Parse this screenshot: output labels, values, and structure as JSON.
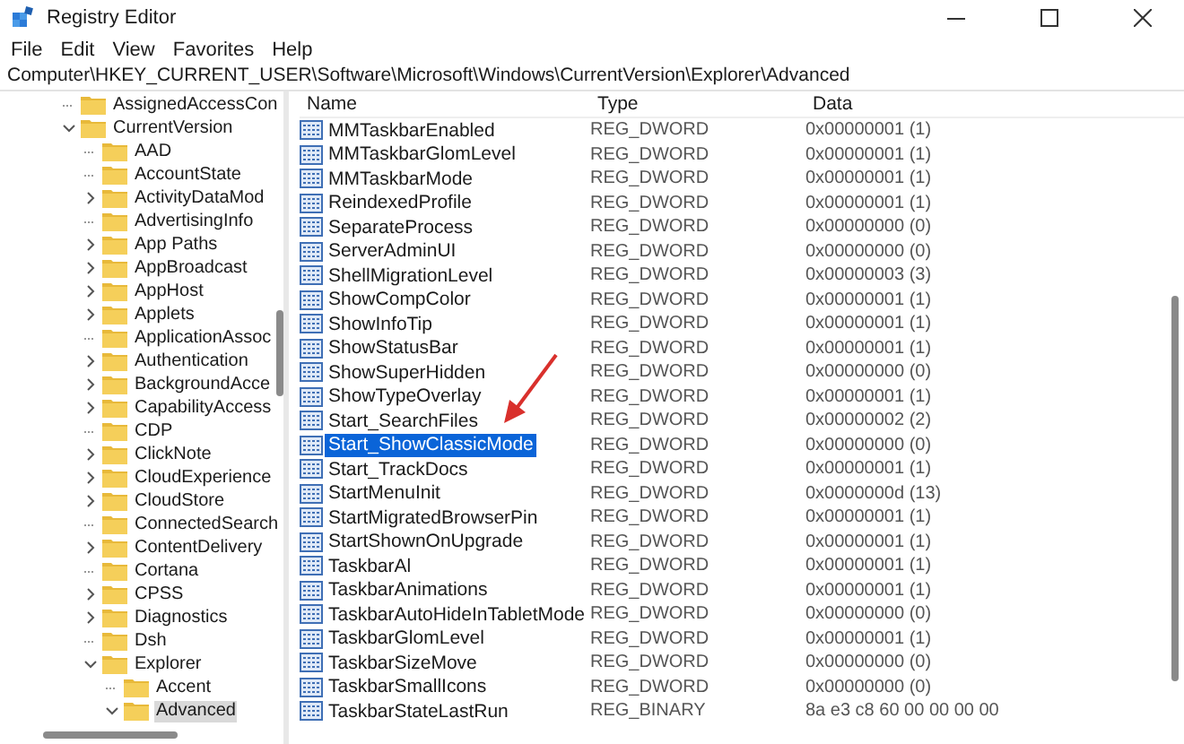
{
  "window": {
    "title": "Registry Editor"
  },
  "menu": [
    {
      "label": "File"
    },
    {
      "label": "Edit"
    },
    {
      "label": "View"
    },
    {
      "label": "Favorites"
    },
    {
      "label": "Help"
    }
  ],
  "address": "Computer\\HKEY_CURRENT_USER\\Software\\Microsoft\\Windows\\CurrentVersion\\Explorer\\Advanced",
  "tree": [
    {
      "label": "AssignedAccessCon",
      "kind": "leaf",
      "selected": false
    },
    {
      "label": "CurrentVersion",
      "kind": "branch",
      "expanded": true,
      "selected": false,
      "children": [
        {
          "label": "AAD",
          "kind": "leaf",
          "selected": false
        },
        {
          "label": "AccountState",
          "kind": "leaf",
          "selected": false
        },
        {
          "label": "ActivityDataMod",
          "kind": "branch",
          "expanded": false,
          "selected": false
        },
        {
          "label": "AdvertisingInfo",
          "kind": "leaf",
          "selected": false
        },
        {
          "label": "App Paths",
          "kind": "branch",
          "expanded": false,
          "selected": false
        },
        {
          "label": "AppBroadcast",
          "kind": "branch",
          "expanded": false,
          "selected": false
        },
        {
          "label": "AppHost",
          "kind": "branch",
          "expanded": false,
          "selected": false
        },
        {
          "label": "Applets",
          "kind": "branch",
          "expanded": false,
          "selected": false
        },
        {
          "label": "ApplicationAssoc",
          "kind": "leaf",
          "selected": false
        },
        {
          "label": "Authentication",
          "kind": "branch",
          "expanded": false,
          "selected": false
        },
        {
          "label": "BackgroundAcce",
          "kind": "branch",
          "expanded": false,
          "selected": false
        },
        {
          "label": "CapabilityAccess",
          "kind": "branch",
          "expanded": false,
          "selected": false
        },
        {
          "label": "CDP",
          "kind": "leaf",
          "selected": false
        },
        {
          "label": "ClickNote",
          "kind": "branch",
          "expanded": false,
          "selected": false
        },
        {
          "label": "CloudExperience",
          "kind": "branch",
          "expanded": false,
          "selected": false
        },
        {
          "label": "CloudStore",
          "kind": "branch",
          "expanded": false,
          "selected": false
        },
        {
          "label": "ConnectedSearch",
          "kind": "leaf",
          "selected": false
        },
        {
          "label": "ContentDelivery",
          "kind": "branch",
          "expanded": false,
          "selected": false
        },
        {
          "label": "Cortana",
          "kind": "leaf",
          "selected": false
        },
        {
          "label": "CPSS",
          "kind": "branch",
          "expanded": false,
          "selected": false
        },
        {
          "label": "Diagnostics",
          "kind": "branch",
          "expanded": false,
          "selected": false
        },
        {
          "label": "Dsh",
          "kind": "leaf",
          "selected": false
        },
        {
          "label": "Explorer",
          "kind": "branch",
          "expanded": true,
          "selected": false,
          "children": [
            {
              "label": "Accent",
              "kind": "leaf",
              "selected": false
            },
            {
              "label": "Advanced",
              "kind": "branch",
              "expanded": true,
              "selected": true
            }
          ]
        }
      ]
    }
  ],
  "table": {
    "columns": [
      "Name",
      "Type",
      "Data"
    ],
    "rows": [
      {
        "name": "MMTaskbarEnabled",
        "type": "REG_DWORD",
        "data": "0x00000001 (1)",
        "selected": false
      },
      {
        "name": "MMTaskbarGlomLevel",
        "type": "REG_DWORD",
        "data": "0x00000001 (1)",
        "selected": false
      },
      {
        "name": "MMTaskbarMode",
        "type": "REG_DWORD",
        "data": "0x00000001 (1)",
        "selected": false
      },
      {
        "name": "ReindexedProfile",
        "type": "REG_DWORD",
        "data": "0x00000001 (1)",
        "selected": false
      },
      {
        "name": "SeparateProcess",
        "type": "REG_DWORD",
        "data": "0x00000000 (0)",
        "selected": false
      },
      {
        "name": "ServerAdminUI",
        "type": "REG_DWORD",
        "data": "0x00000000 (0)",
        "selected": false
      },
      {
        "name": "ShellMigrationLevel",
        "type": "REG_DWORD",
        "data": "0x00000003 (3)",
        "selected": false
      },
      {
        "name": "ShowCompColor",
        "type": "REG_DWORD",
        "data": "0x00000001 (1)",
        "selected": false
      },
      {
        "name": "ShowInfoTip",
        "type": "REG_DWORD",
        "data": "0x00000001 (1)",
        "selected": false
      },
      {
        "name": "ShowStatusBar",
        "type": "REG_DWORD",
        "data": "0x00000001 (1)",
        "selected": false
      },
      {
        "name": "ShowSuperHidden",
        "type": "REG_DWORD",
        "data": "0x00000000 (0)",
        "selected": false
      },
      {
        "name": "ShowTypeOverlay",
        "type": "REG_DWORD",
        "data": "0x00000001 (1)",
        "selected": false
      },
      {
        "name": "Start_SearchFiles",
        "type": "REG_DWORD",
        "data": "0x00000002 (2)",
        "selected": false
      },
      {
        "name": "Start_ShowClassicMode",
        "type": "REG_DWORD",
        "data": "0x00000000 (0)",
        "selected": true
      },
      {
        "name": "Start_TrackDocs",
        "type": "REG_DWORD",
        "data": "0x00000001 (1)",
        "selected": false
      },
      {
        "name": "StartMenuInit",
        "type": "REG_DWORD",
        "data": "0x0000000d (13)",
        "selected": false
      },
      {
        "name": "StartMigratedBrowserPin",
        "type": "REG_DWORD",
        "data": "0x00000001 (1)",
        "selected": false
      },
      {
        "name": "StartShownOnUpgrade",
        "type": "REG_DWORD",
        "data": "0x00000001 (1)",
        "selected": false
      },
      {
        "name": "TaskbarAl",
        "type": "REG_DWORD",
        "data": "0x00000001 (1)",
        "selected": false
      },
      {
        "name": "TaskbarAnimations",
        "type": "REG_DWORD",
        "data": "0x00000001 (1)",
        "selected": false
      },
      {
        "name": "TaskbarAutoHideInTabletMode",
        "type": "REG_DWORD",
        "data": "0x00000000 (0)",
        "selected": false
      },
      {
        "name": "TaskbarGlomLevel",
        "type": "REG_DWORD",
        "data": "0x00000001 (1)",
        "selected": false
      },
      {
        "name": "TaskbarSizeMove",
        "type": "REG_DWORD",
        "data": "0x00000000 (0)",
        "selected": false
      },
      {
        "name": "TaskbarSmallIcons",
        "type": "REG_DWORD",
        "data": "0x00000000 (0)",
        "selected": false
      },
      {
        "name": "TaskbarStateLastRun",
        "type": "REG_BINARY",
        "data": "8a e3 c8 60 00 00 00 00",
        "selected": false
      }
    ]
  }
}
